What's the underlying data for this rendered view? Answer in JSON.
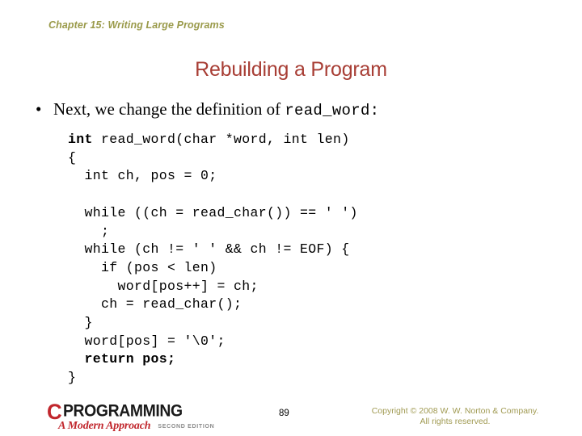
{
  "header": {
    "chapter": "Chapter 15: Writing Large Programs"
  },
  "title": "Rebuilding a Program",
  "bullet": {
    "marker": "•",
    "text_before": "Next, we change the definition of ",
    "code_name": "read_word",
    "text_after": ":"
  },
  "code": {
    "lines": [
      [
        {
          "t": "int",
          "b": true
        },
        {
          "t": " read_word(char *word, int len)",
          "b": false
        }
      ],
      [
        {
          "t": "{",
          "b": false
        }
      ],
      [
        {
          "t": "  int ch, pos = 0;",
          "b": false
        }
      ],
      [],
      [
        {
          "t": "  while ((ch = read_char()) == ' ')",
          "b": false
        }
      ],
      [
        {
          "t": "    ;",
          "b": false
        }
      ],
      [
        {
          "t": "  while (ch != ' ' && ch != EOF) {",
          "b": false
        }
      ],
      [
        {
          "t": "    if (pos < len)",
          "b": false
        }
      ],
      [
        {
          "t": "      word[pos++] = ch;",
          "b": false
        }
      ],
      [
        {
          "t": "    ch = read_char();",
          "b": false
        }
      ],
      [
        {
          "t": "  }",
          "b": false
        }
      ],
      [
        {
          "t": "  word[pos] = '\\0';",
          "b": false
        }
      ],
      [
        {
          "t": "  return pos;",
          "b": true
        }
      ],
      [
        {
          "t": "}",
          "b": false
        }
      ]
    ]
  },
  "footer": {
    "logo": {
      "letter_c": "C",
      "wordmark": "PROGRAMMING",
      "tagline": "A Modern Approach",
      "edition": "SECOND EDITION"
    },
    "page_number": "89",
    "copyright_line1": "Copyright © 2008 W. W. Norton & Company.",
    "copyright_line2": "All rights reserved."
  },
  "colors": {
    "header_olive": "#9a9a4a",
    "title_red": "#a83e35",
    "logo_red": "#c1272d",
    "copyright_olive": "#a09a52",
    "background": "#ffffff"
  }
}
